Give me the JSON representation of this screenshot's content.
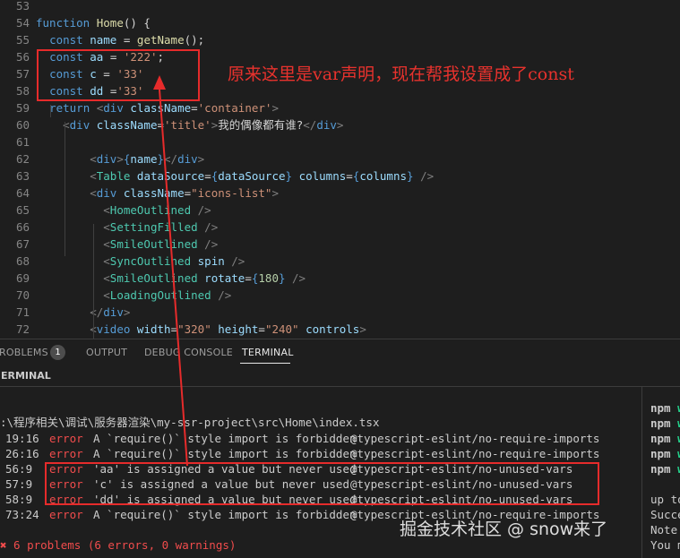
{
  "editor": {
    "lines": [
      {
        "num": "53",
        "tokens": []
      },
      {
        "num": "54",
        "tokens": [
          {
            "c": "kw",
            "t": "function"
          },
          {
            "c": "tx",
            "t": " "
          },
          {
            "c": "fn",
            "t": "Home"
          },
          {
            "c": "tx",
            "t": "() {"
          }
        ]
      },
      {
        "num": "55",
        "tokens": [
          {
            "c": "tx",
            "t": "  "
          },
          {
            "c": "kw",
            "t": "const"
          },
          {
            "c": "tx",
            "t": " "
          },
          {
            "c": "vr",
            "t": "name"
          },
          {
            "c": "tx",
            "t": " = "
          },
          {
            "c": "fn",
            "t": "getName"
          },
          {
            "c": "tx",
            "t": "();"
          }
        ]
      },
      {
        "num": "56",
        "tokens": [
          {
            "c": "tx",
            "t": "  "
          },
          {
            "c": "kw",
            "t": "const"
          },
          {
            "c": "tx",
            "t": " "
          },
          {
            "c": "vr",
            "t": "aa"
          },
          {
            "c": "tx",
            "t": " = "
          },
          {
            "c": "st",
            "t": "'222'"
          },
          {
            "c": "tx",
            "t": ";"
          }
        ]
      },
      {
        "num": "57",
        "tokens": [
          {
            "c": "tx",
            "t": "  "
          },
          {
            "c": "kw",
            "t": "const"
          },
          {
            "c": "tx",
            "t": " "
          },
          {
            "c": "vr",
            "t": "c"
          },
          {
            "c": "tx",
            "t": " = "
          },
          {
            "c": "st",
            "t": "'33'"
          }
        ]
      },
      {
        "num": "58",
        "tokens": [
          {
            "c": "tx",
            "t": "  "
          },
          {
            "c": "kw",
            "t": "const"
          },
          {
            "c": "tx",
            "t": " "
          },
          {
            "c": "vr",
            "t": "dd"
          },
          {
            "c": "tx",
            "t": " ="
          },
          {
            "c": "st",
            "t": "'33'"
          }
        ]
      },
      {
        "num": "59",
        "tokens": [
          {
            "c": "tx",
            "t": "  "
          },
          {
            "c": "kw",
            "t": "return"
          },
          {
            "c": "tx",
            "t": " "
          },
          {
            "c": "tg",
            "t": "<"
          },
          {
            "c": "tg2",
            "t": "div"
          },
          {
            "c": "tx",
            "t": " "
          },
          {
            "c": "vr",
            "t": "className"
          },
          {
            "c": "tx",
            "t": "="
          },
          {
            "c": "st",
            "t": "'container'"
          },
          {
            "c": "tg",
            "t": ">"
          }
        ]
      },
      {
        "num": "60",
        "tokens": [
          {
            "c": "tx",
            "t": "    "
          },
          {
            "c": "tg",
            "t": "<"
          },
          {
            "c": "tg2",
            "t": "div"
          },
          {
            "c": "tx",
            "t": " "
          },
          {
            "c": "vr",
            "t": "className"
          },
          {
            "c": "tx",
            "t": "="
          },
          {
            "c": "st",
            "t": "'title'"
          },
          {
            "c": "tg",
            "t": ">"
          },
          {
            "c": "tx",
            "t": "我的偶像都有谁?"
          },
          {
            "c": "tg",
            "t": "</"
          },
          {
            "c": "tg2",
            "t": "div"
          },
          {
            "c": "tg",
            "t": ">"
          }
        ]
      },
      {
        "num": "61",
        "tokens": []
      },
      {
        "num": "62",
        "tokens": [
          {
            "c": "tx",
            "t": "        "
          },
          {
            "c": "tg",
            "t": "<"
          },
          {
            "c": "tg2",
            "t": "div"
          },
          {
            "c": "tg",
            "t": ">"
          },
          {
            "c": "kw",
            "t": "{"
          },
          {
            "c": "vr",
            "t": "name"
          },
          {
            "c": "kw",
            "t": "}"
          },
          {
            "c": "tg",
            "t": "</"
          },
          {
            "c": "tg2",
            "t": "div"
          },
          {
            "c": "tg",
            "t": ">"
          }
        ]
      },
      {
        "num": "63",
        "tokens": [
          {
            "c": "tx",
            "t": "        "
          },
          {
            "c": "tg",
            "t": "<"
          },
          {
            "c": "cp",
            "t": "Table"
          },
          {
            "c": "tx",
            "t": " "
          },
          {
            "c": "vr",
            "t": "dataSource"
          },
          {
            "c": "tx",
            "t": "="
          },
          {
            "c": "kw",
            "t": "{"
          },
          {
            "c": "vr",
            "t": "dataSource"
          },
          {
            "c": "kw",
            "t": "}"
          },
          {
            "c": "tx",
            "t": " "
          },
          {
            "c": "vr",
            "t": "columns"
          },
          {
            "c": "tx",
            "t": "="
          },
          {
            "c": "kw",
            "t": "{"
          },
          {
            "c": "vr",
            "t": "columns"
          },
          {
            "c": "kw",
            "t": "}"
          },
          {
            "c": "tx",
            "t": " "
          },
          {
            "c": "tg",
            "t": "/>"
          }
        ]
      },
      {
        "num": "64",
        "tokens": [
          {
            "c": "tx",
            "t": "        "
          },
          {
            "c": "tg",
            "t": "<"
          },
          {
            "c": "tg2",
            "t": "div"
          },
          {
            "c": "tx",
            "t": " "
          },
          {
            "c": "vr",
            "t": "className"
          },
          {
            "c": "tx",
            "t": "="
          },
          {
            "c": "st",
            "t": "\"icons-list\""
          },
          {
            "c": "tg",
            "t": ">"
          }
        ]
      },
      {
        "num": "65",
        "tokens": [
          {
            "c": "tx",
            "t": "          "
          },
          {
            "c": "tg",
            "t": "<"
          },
          {
            "c": "cp",
            "t": "HomeOutlined"
          },
          {
            "c": "tx",
            "t": " "
          },
          {
            "c": "tg",
            "t": "/>"
          }
        ]
      },
      {
        "num": "66",
        "tokens": [
          {
            "c": "tx",
            "t": "          "
          },
          {
            "c": "tg",
            "t": "<"
          },
          {
            "c": "cp",
            "t": "SettingFilled"
          },
          {
            "c": "tx",
            "t": " "
          },
          {
            "c": "tg",
            "t": "/>"
          }
        ]
      },
      {
        "num": "67",
        "tokens": [
          {
            "c": "tx",
            "t": "          "
          },
          {
            "c": "tg",
            "t": "<"
          },
          {
            "c": "cp",
            "t": "SmileOutlined"
          },
          {
            "c": "tx",
            "t": " "
          },
          {
            "c": "tg",
            "t": "/>"
          }
        ]
      },
      {
        "num": "68",
        "tokens": [
          {
            "c": "tx",
            "t": "          "
          },
          {
            "c": "tg",
            "t": "<"
          },
          {
            "c": "cp",
            "t": "SyncOutlined"
          },
          {
            "c": "tx",
            "t": " "
          },
          {
            "c": "vr",
            "t": "spin"
          },
          {
            "c": "tx",
            "t": " "
          },
          {
            "c": "tg",
            "t": "/>"
          }
        ]
      },
      {
        "num": "69",
        "tokens": [
          {
            "c": "tx",
            "t": "          "
          },
          {
            "c": "tg",
            "t": "<"
          },
          {
            "c": "cp",
            "t": "SmileOutlined"
          },
          {
            "c": "tx",
            "t": " "
          },
          {
            "c": "vr",
            "t": "rotate"
          },
          {
            "c": "tx",
            "t": "="
          },
          {
            "c": "kw",
            "t": "{"
          },
          {
            "c": "nm",
            "t": "180"
          },
          {
            "c": "kw",
            "t": "}"
          },
          {
            "c": "tx",
            "t": " "
          },
          {
            "c": "tg",
            "t": "/>"
          }
        ]
      },
      {
        "num": "70",
        "tokens": [
          {
            "c": "tx",
            "t": "          "
          },
          {
            "c": "tg",
            "t": "<"
          },
          {
            "c": "cp",
            "t": "LoadingOutlined"
          },
          {
            "c": "tx",
            "t": " "
          },
          {
            "c": "tg",
            "t": "/>"
          }
        ]
      },
      {
        "num": "71",
        "tokens": [
          {
            "c": "tx",
            "t": "        "
          },
          {
            "c": "tg",
            "t": "</"
          },
          {
            "c": "tg2",
            "t": "div"
          },
          {
            "c": "tg",
            "t": ">"
          }
        ]
      },
      {
        "num": "72",
        "tokens": [
          {
            "c": "tx",
            "t": "        "
          },
          {
            "c": "tg",
            "t": "<"
          },
          {
            "c": "tg2",
            "t": "video"
          },
          {
            "c": "tx",
            "t": " "
          },
          {
            "c": "vr",
            "t": "width"
          },
          {
            "c": "tx",
            "t": "="
          },
          {
            "c": "st",
            "t": "\"320\""
          },
          {
            "c": "tx",
            "t": " "
          },
          {
            "c": "vr",
            "t": "height"
          },
          {
            "c": "tx",
            "t": "="
          },
          {
            "c": "st",
            "t": "\"240\""
          },
          {
            "c": "tx",
            "t": " "
          },
          {
            "c": "vr",
            "t": "controls"
          },
          {
            "c": "tg",
            "t": ">"
          }
        ]
      }
    ]
  },
  "annotation": {
    "note": "原来这里是var声明，现在帮我设置成了const",
    "color": "#e62b2b"
  },
  "panel": {
    "tabs": [
      {
        "label": "ROBLEMS",
        "active": false
      },
      {
        "label": "OUTPUT",
        "active": false
      },
      {
        "label": "DEBUG CONSOLE",
        "active": false
      },
      {
        "label": "TERMINAL",
        "active": true
      }
    ],
    "problems_count": "1",
    "terminal_title": "ERMINAL"
  },
  "terminal": {
    "path": ":\\程序相关\\调试\\服务器渲染\\my-ssr-project\\src\\Home\\index.tsx",
    "errors": [
      {
        "loc": "19:16",
        "sev": "error",
        "msg": "A `require()` style import is forbidden",
        "rule": "@typescript-eslint/no-require-imports"
      },
      {
        "loc": "26:16",
        "sev": "error",
        "msg": "A `require()` style import is forbidden",
        "rule": "@typescript-eslint/no-require-imports"
      },
      {
        "loc": "56:9",
        "sev": "error",
        "msg": "'aa' is assigned a value but never used",
        "rule": "@typescript-eslint/no-unused-vars"
      },
      {
        "loc": "57:9",
        "sev": "error",
        "msg": "'c' is assigned a value but never used",
        "rule": "@typescript-eslint/no-unused-vars"
      },
      {
        "loc": "58:9",
        "sev": "error",
        "msg": "'dd' is assigned a value but never used",
        "rule": "@typescript-eslint/no-unused-vars"
      },
      {
        "loc": "73:24",
        "sev": "error",
        "msg": "A `require()` style import is forbidden",
        "rule": "@typescript-eslint/no-require-imports"
      }
    ],
    "summary": "✖ 6 problems (6 errors, 0 warnings)"
  },
  "side_terminal": {
    "lines": [
      {
        "a": "npm ",
        "b": "w"
      },
      {
        "a": "npm ",
        "b": "w"
      },
      {
        "a": "npm ",
        "b": "w"
      },
      {
        "a": "npm ",
        "b": "w"
      },
      {
        "a": "npm ",
        "b": "w"
      },
      {
        "a": "",
        "b": ""
      },
      {
        "a": "up to",
        "b": ""
      },
      {
        "a": "Succe",
        "b": ""
      },
      {
        "a": "Note",
        "b": ""
      },
      {
        "a": "You m",
        "b": ""
      }
    ]
  },
  "watermark": "掘金技术社区 @ snow来了"
}
